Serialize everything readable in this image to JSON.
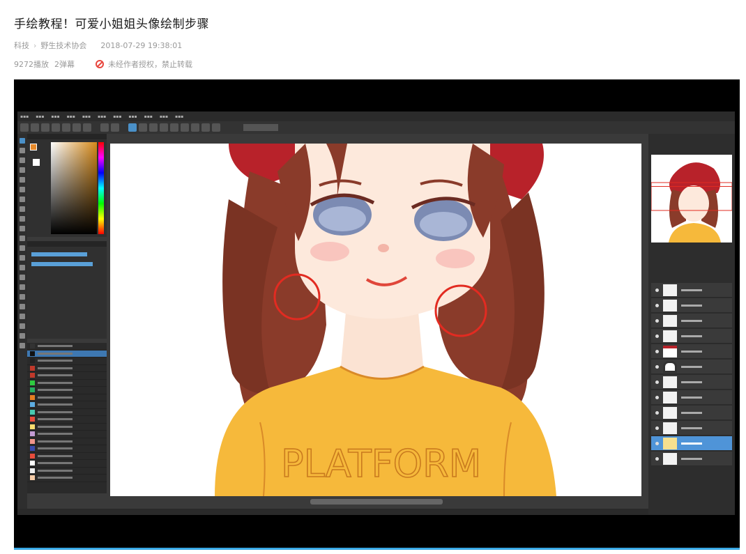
{
  "article": {
    "title": "手绘教程！可爱小姐姐头像绘制步骤",
    "category": "科技",
    "separator": "›",
    "author": "野生技术协会",
    "datetime": "2018-07-29 19:38:01",
    "plays": "9272播放",
    "danmaku": "2弹幕",
    "copyright_notice": "未经作者授权，禁止转载"
  },
  "video": {
    "canvas_text": "PLATFORM"
  },
  "colors": {
    "accent": "#39a9e6",
    "ban": "#e8473e",
    "hat": "#b8222a",
    "hair": "#8a3b2a",
    "sweater": "#f6b93b"
  }
}
